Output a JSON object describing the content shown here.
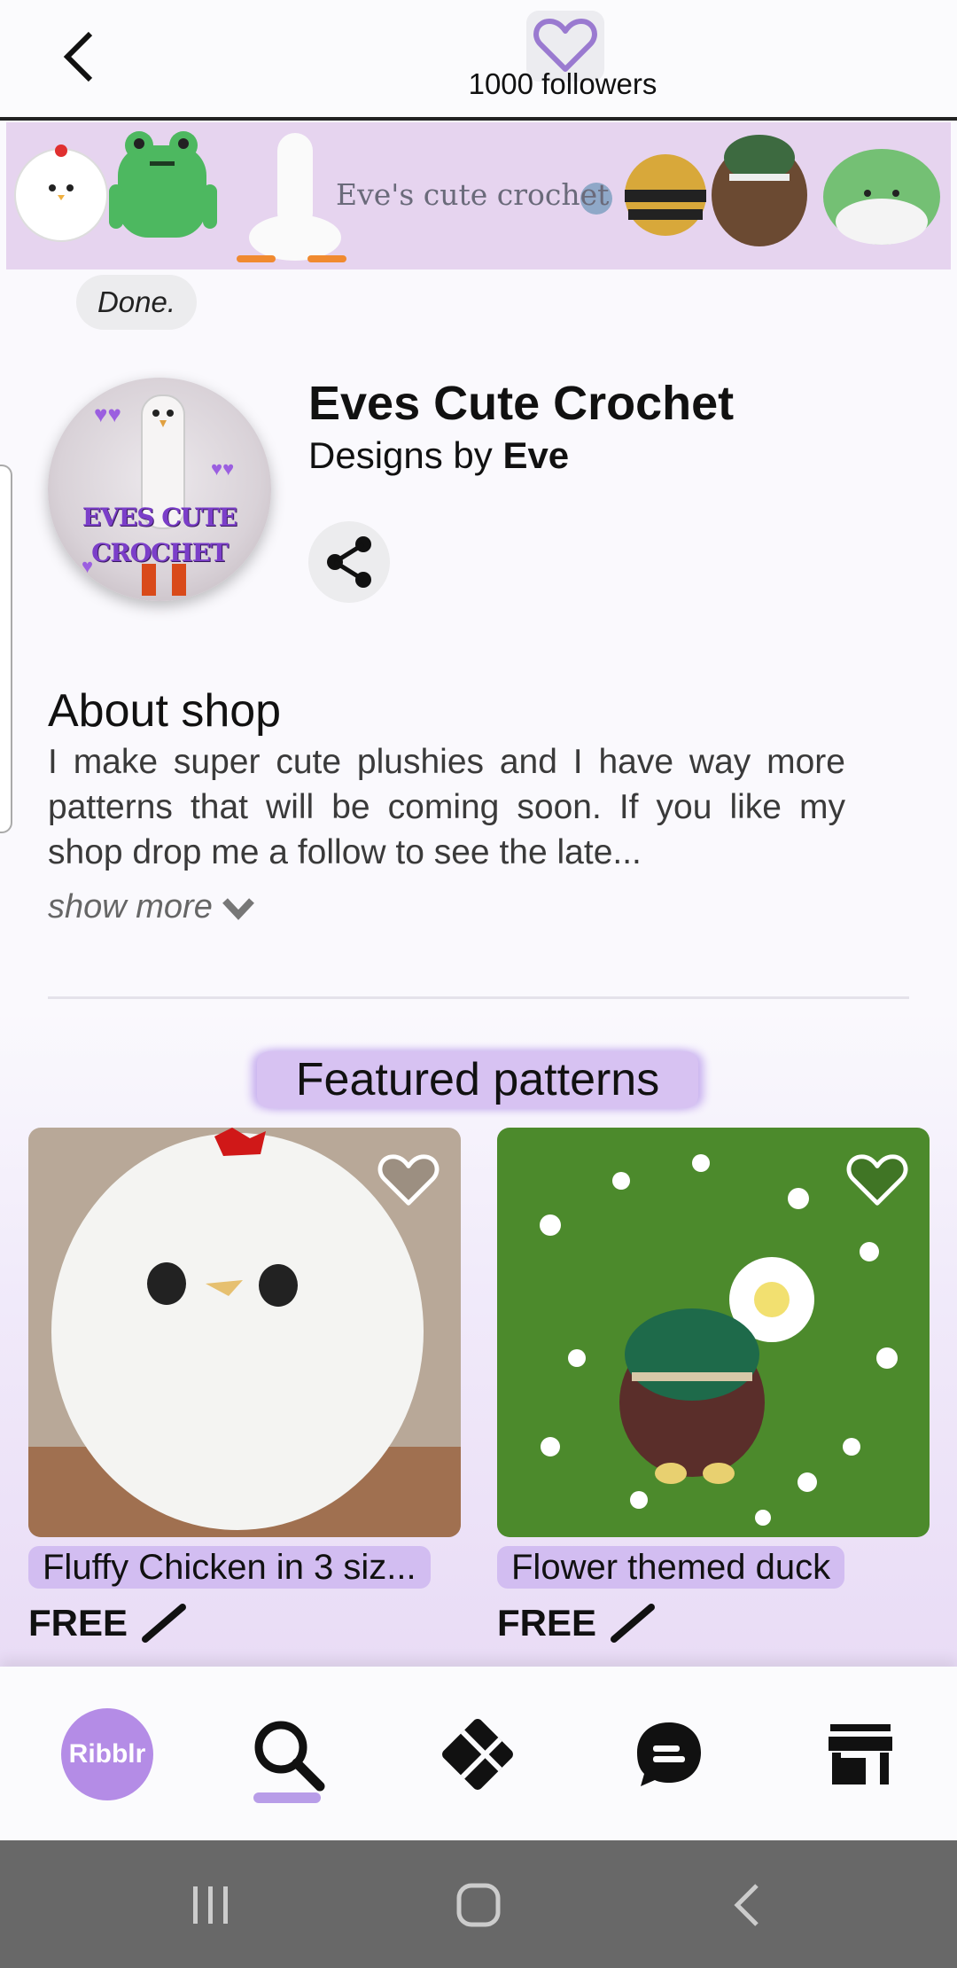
{
  "header": {
    "back_icon": "chevron-left-icon",
    "follow_icon": "heart-outline-icon",
    "followers_text": "1000 followers"
  },
  "banner": {
    "title": "Eve's cute crochet"
  },
  "status_chip": "Done.",
  "shop": {
    "name": "Eves Cute Crochet",
    "designer_prefix": "Designs by",
    "designer_name": "Eve",
    "avatar_text": "EVES CUTE CROCHET"
  },
  "about": {
    "title": "About shop",
    "text": "I make super cute plushies and I have way more patterns that will be coming soon. If you like my shop drop me a follow to see the late...",
    "show_more": "show more"
  },
  "featured": {
    "title": "Featured patterns",
    "items": [
      {
        "title": "Fluffy Chicken in 3 siz...",
        "price": "FREE"
      },
      {
        "title": "Flower themed duck",
        "price": "FREE"
      }
    ]
  },
  "bottom_nav": {
    "items": [
      {
        "label": "Ribblr",
        "icon": "ribblr-logo"
      },
      {
        "label": "",
        "icon": "search-icon"
      },
      {
        "label": "",
        "icon": "patterns-icon"
      },
      {
        "label": "",
        "icon": "chat-icon"
      },
      {
        "label": "",
        "icon": "store-icon"
      }
    ],
    "active_index": 1
  },
  "colors": {
    "accent": "#b48ce6",
    "highlight": "#d2bdf1",
    "banner_bg": "#e6d4ef"
  }
}
